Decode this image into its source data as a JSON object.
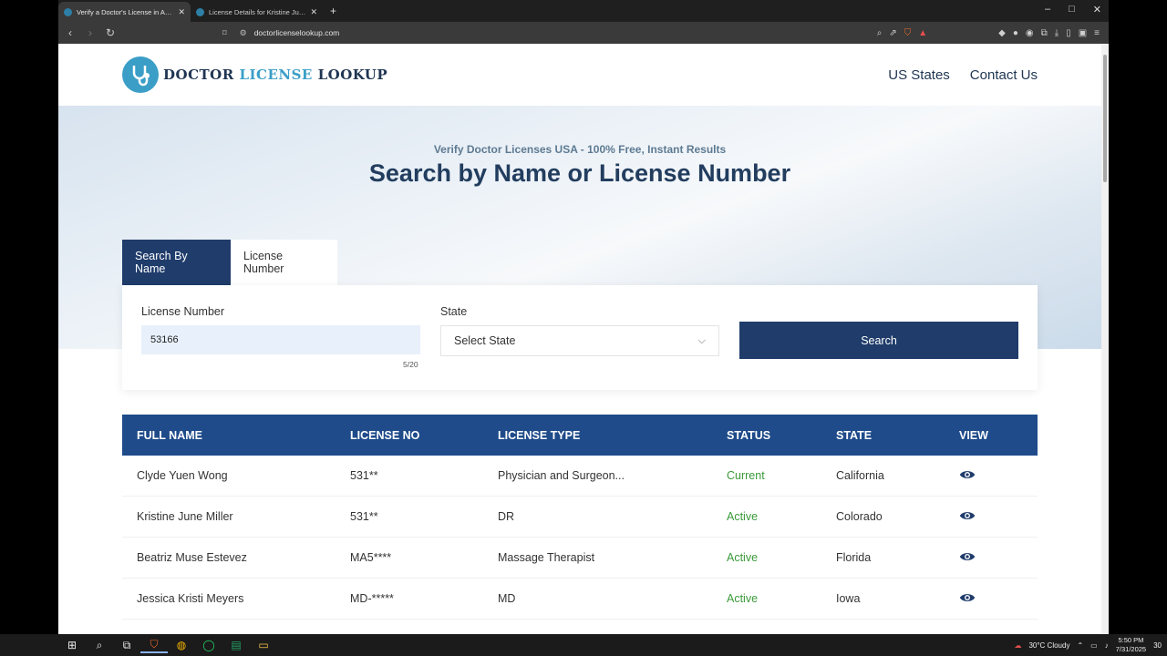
{
  "browser": {
    "tabs": [
      {
        "title": "Verify a Doctor's License in Any U",
        "active": true
      },
      {
        "title": "License Details for Kristine June Miller",
        "active": false
      }
    ],
    "new_tab": "+",
    "url": "doctorlicenselookup.com",
    "window_controls": [
      "–",
      "□",
      "✕"
    ]
  },
  "site": {
    "logo_word1": "DOCTOR ",
    "logo_word2": "LICENSE",
    "logo_word3": " LOOKUP",
    "nav": [
      "US States",
      "Contact Us"
    ]
  },
  "hero": {
    "eyebrow": "Verify Doctor Licenses USA - 100% Free, Instant Results",
    "title": "Search by Name or License Number"
  },
  "search_tabs": [
    "Search By Name",
    "License Number"
  ],
  "form": {
    "license_label": "License Number",
    "license_value": "53166",
    "counter": "5/20",
    "state_label": "State",
    "state_value": "Select State",
    "search_label": "Search"
  },
  "table": {
    "headers": [
      "FULL NAME",
      "LICENSE NO",
      "LICENSE TYPE",
      "STATUS",
      "STATE",
      "VIEW"
    ],
    "rows": [
      {
        "name": "Clyde Yuen Wong",
        "license": "531**",
        "type": "Physician and Surgeon...",
        "status": "Current",
        "state": "California"
      },
      {
        "name": "Kristine June Miller",
        "license": "531**",
        "type": "DR",
        "status": "Active",
        "state": "Colorado"
      },
      {
        "name": "Beatriz Muse Estevez",
        "license": "MA5****",
        "type": "Massage Therapist",
        "status": "Active",
        "state": "Florida"
      },
      {
        "name": "Jessica Kristi Meyers",
        "license": "MD-*****",
        "type": "MD",
        "status": "Active",
        "state": "Iowa"
      }
    ]
  },
  "taskbar": {
    "weather": "30°C  Cloudy",
    "time": "5:50 PM",
    "date": "7/31/2025",
    "notif": "30"
  },
  "colors": {
    "primary": "#1f3c6b",
    "header": "#1f4b8a",
    "accent": "#3b9ec7",
    "status": "#3a9a3a"
  }
}
